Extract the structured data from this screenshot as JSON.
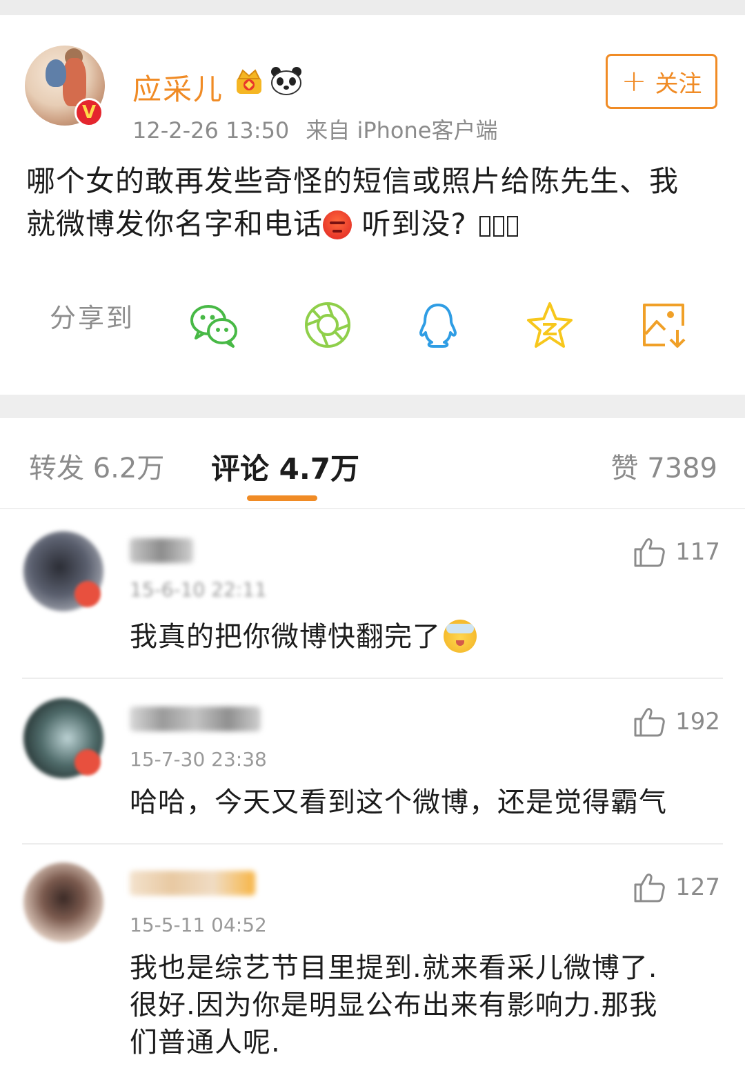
{
  "post": {
    "username": "应采儿",
    "time": "12-2-26 13:50",
    "source": "来自 iPhone客户端",
    "follow_label": "关注",
    "follow_plus": "+",
    "verified_badge": "V",
    "text_line1": "哪个女的敢再发些奇怪的短信或照片给陈先生、我",
    "text_line2_a": "就微博发你名字和电话",
    "text_line2_b": " 听到没? ",
    "icons": [
      "crown-icon",
      "panda-icon",
      "angry-emoji-icon"
    ]
  },
  "share": {
    "label": "分享到",
    "targets": [
      "wechat-icon",
      "moments-icon",
      "qq-icon",
      "qzone-icon",
      "save-image-icon"
    ],
    "colors": {
      "wechat": "#48b946",
      "moments": "#8fcf4a",
      "qq": "#2f9de4",
      "qzone": "#f7c71c",
      "save": "#f0a028"
    }
  },
  "tabs": {
    "repost": "转发 6.2万",
    "comment": "评论 4.7万",
    "likes": "赞 7389"
  },
  "comments": [
    {
      "time": "15-6-10 22:11",
      "likes": "117",
      "text": "我真的把你微博快翻完了"
    },
    {
      "time": "15-7-30 23:38",
      "likes": "192",
      "text": "哈哈，今天又看到这个微博，还是觉得霸气"
    },
    {
      "time": "15-5-11 04:52",
      "likes": "127",
      "text_line1": "我也是综艺节目里提到.就来看采儿微博了.",
      "text_line2": "很好.因为你是明显公布出来有影响力.那我",
      "text_line3": "们普通人呢."
    }
  ],
  "colors": {
    "accent": "#f08b25",
    "text": "#1c1c1c",
    "muted": "#8b8b8b"
  }
}
